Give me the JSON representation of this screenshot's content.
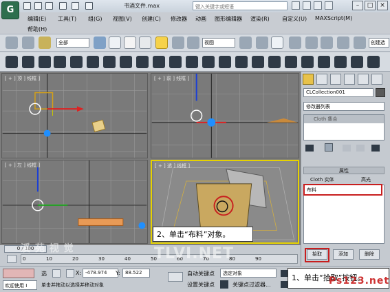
{
  "title": "书酒文件.max",
  "search_placeholder": "键入关键字或短语",
  "menu": [
    "编辑(E)",
    "工具(T)",
    "组(G)",
    "视图(V)",
    "创建(C)",
    "修改器",
    "动画",
    "图形编辑器",
    "渲染(R)",
    "自定义(U)",
    "MAXScript(M)",
    "帮助(H)"
  ],
  "toolbar": {
    "filter_select": "全部",
    "view_select": "视图",
    "named_sel": "创建选"
  },
  "viewports": [
    {
      "label": "[ + ] 顶 ] 线框 ]"
    },
    {
      "label": "[ + ] 前 ] 线框 ]"
    },
    {
      "label": "[ + ] 左 ] 线框 ]"
    },
    {
      "label": "[ + ] 透 ] 线框 ]"
    }
  ],
  "panel": {
    "object_name": "CLCollection001",
    "modifier_list": "修改器列表",
    "stack_item": "Cloth 集合",
    "rollout_title": "属性",
    "col_left": "Cloth 实体",
    "col_right": "高光",
    "list_item": "布料",
    "pick_button": "拾取",
    "add_button": "添加",
    "remove_button": "删除"
  },
  "timeline": {
    "frame": "0 / 100",
    "ticks": [
      "0",
      "10",
      "20",
      "30",
      "40",
      "50",
      "60",
      "70",
      "80",
      "90"
    ]
  },
  "status": {
    "welcome": "欢迎使用 I",
    "select_label": "选",
    "prompt": "单击并拖动以选择并移动对象",
    "x_label": "X:",
    "x_value": "-478.974",
    "y_label": "Y:",
    "y_value": "88.522",
    "auto_key": "自动关键点",
    "set_key": "设置关键点",
    "selected_object": "选定对象",
    "key_filter": "关键点过滤器..."
  },
  "callouts": {
    "step1": "1、单击“拾取”按钮。",
    "step2": "2、单击“布料”对象。"
  },
  "watermark": {
    "left": "TLVI.NET",
    "right": "Ps123.net",
    "brand": "溪 苑 视 觉"
  }
}
